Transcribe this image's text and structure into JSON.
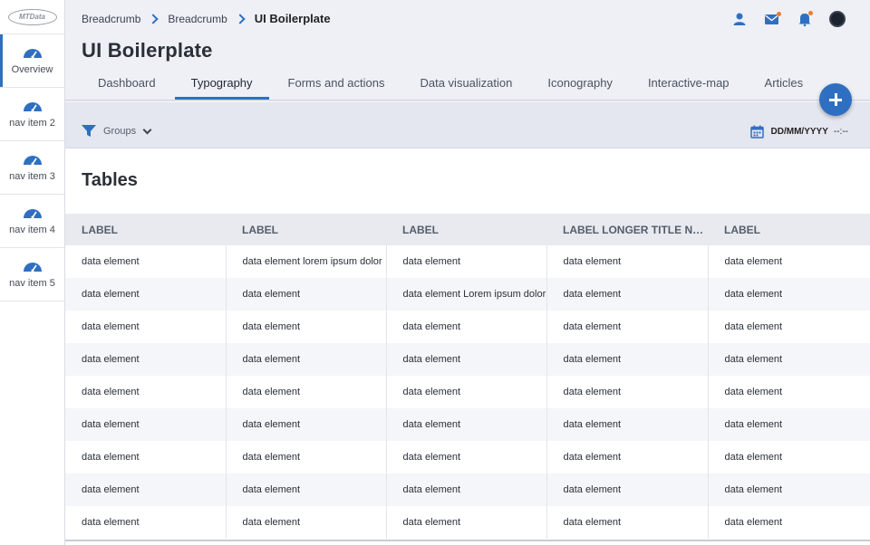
{
  "sidebar": {
    "logo_text": "MTData",
    "items": [
      {
        "label": "Overview",
        "active": true
      },
      {
        "label": "nav item 2"
      },
      {
        "label": "nav item 3"
      },
      {
        "label": "nav item 4"
      },
      {
        "label": "nav item 5"
      }
    ]
  },
  "header": {
    "breadcrumbs": [
      "Breadcrumb",
      "Breadcrumb",
      "UI Boilerplate"
    ],
    "title": "UI Boilerplate",
    "tabs": [
      "Dashboard",
      "Typography",
      "Forms and actions",
      "Data visualization",
      "Iconography",
      "Interactive-map",
      "Articles"
    ],
    "active_tab": "Typography",
    "icons": [
      "user-icon",
      "mail-icon",
      "bell-icon",
      "avatar"
    ]
  },
  "filter": {
    "groups_label": "Groups",
    "date_placeholder": "DD/MM/YYYY",
    "time_placeholder": "--:--"
  },
  "section": {
    "title": "Tables"
  },
  "table": {
    "headers": [
      "LABEL",
      "LABEL",
      "LABEL",
      "LABEL LONGER TITLE NAME",
      "LABEL"
    ],
    "rows": [
      [
        "data element",
        "data element lorem ipsum dolor",
        "data element",
        "data element",
        "data element"
      ],
      [
        "data element",
        "data element",
        "data element Lorem ipsum dolor",
        "data element",
        "data element"
      ],
      [
        "data element",
        "data element",
        "data element",
        "data element",
        "data element"
      ],
      [
        "data element",
        "data element",
        "data element",
        "data element",
        "data element"
      ],
      [
        "data element",
        "data element",
        "data element",
        "data element",
        "data element"
      ],
      [
        "data element",
        "data element",
        "data element",
        "data element",
        "data element"
      ],
      [
        "data element",
        "data element",
        "data element",
        "data element",
        "data element"
      ],
      [
        "data element",
        "data element",
        "data element",
        "data element",
        "data element"
      ],
      [
        "data element",
        "data element",
        "data element",
        "data element",
        "data element"
      ]
    ]
  },
  "colors": {
    "accent": "#2f6fc1",
    "badge": "#f07c2a",
    "header_bg": "#eef0f5",
    "filter_bg": "#e4e7f0"
  }
}
